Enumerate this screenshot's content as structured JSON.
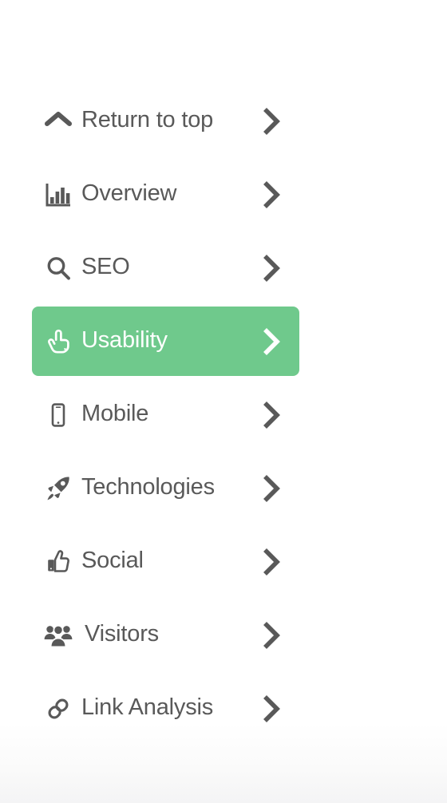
{
  "menu": {
    "accent_color": "#6fc98c",
    "text_color": "#595959",
    "active_text_color": "#ffffff",
    "background_color": "#ffffff",
    "items": [
      {
        "key": "return-to-top",
        "label": "Return to top",
        "icon": "chevron-up-icon",
        "chevron": "chevron-right-icon",
        "active": false
      },
      {
        "key": "overview",
        "label": "Overview",
        "icon": "bar-chart-icon",
        "chevron": "chevron-right-icon",
        "active": false
      },
      {
        "key": "seo",
        "label": "SEO",
        "icon": "search-icon",
        "chevron": "chevron-right-icon",
        "active": false
      },
      {
        "key": "usability",
        "label": "Usability",
        "icon": "pointing-hand-icon",
        "chevron": "chevron-right-icon",
        "active": true
      },
      {
        "key": "mobile",
        "label": "Mobile",
        "icon": "smartphone-icon",
        "chevron": "chevron-right-icon",
        "active": false
      },
      {
        "key": "technologies",
        "label": "Technologies",
        "icon": "rocket-icon",
        "chevron": "chevron-right-icon",
        "active": false
      },
      {
        "key": "social",
        "label": "Social",
        "icon": "thumbs-up-icon",
        "chevron": "chevron-right-icon",
        "active": false
      },
      {
        "key": "visitors",
        "label": "Visitors",
        "icon": "people-group-icon",
        "chevron": "chevron-right-icon",
        "active": false
      },
      {
        "key": "link-analysis",
        "label": "Link Analysis",
        "icon": "chain-link-icon",
        "chevron": "chevron-right-icon",
        "active": false
      }
    ]
  }
}
